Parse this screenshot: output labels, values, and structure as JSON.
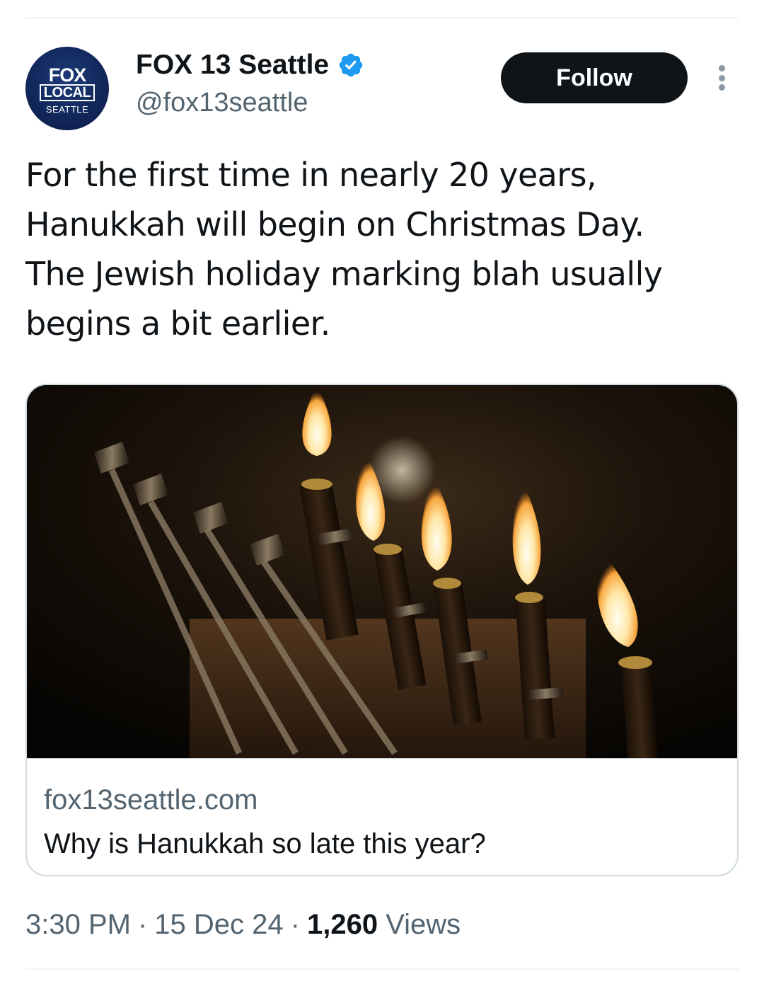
{
  "author": {
    "display_name": "FOX 13 Seattle",
    "handle": "@fox13seattle",
    "avatar": {
      "line1": "FOX",
      "line2": "LOCAL",
      "line3": "SEATTLE"
    },
    "verified_icon": "verified-badge-icon",
    "verified_color": "#1d9bf0"
  },
  "actions": {
    "follow_label": "Follow",
    "more_icon": "more-options-icon"
  },
  "tweet": {
    "text_lines": [
      "For the first time in nearly 20 years,",
      "Hanukkah will begin on Christmas Day.",
      "The Jewish holiday marking blah usually",
      "begins a bit earlier."
    ]
  },
  "link_card": {
    "domain": "fox13seattle.com",
    "title": "Why is Hanukkah so late this year?"
  },
  "meta": {
    "time": "3:30 PM",
    "separator": "·",
    "date": "15 Dec 24",
    "views_count": "1,260",
    "views_label": "Views"
  },
  "colors": {
    "text_primary": "#0f1419",
    "text_secondary": "#536471",
    "follow_bg": "#0f1419",
    "border": "#cfd9de"
  }
}
